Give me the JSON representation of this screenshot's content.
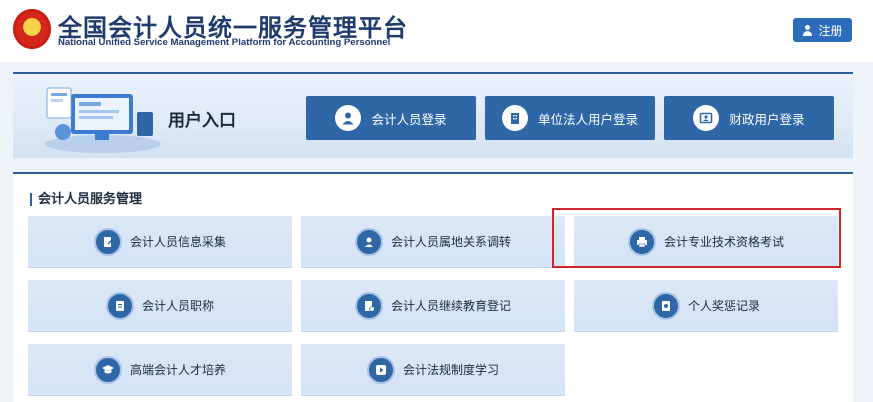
{
  "header": {
    "title": "全国会计人员统一服务管理平台",
    "subtitle": "National Unified Service Management Platform for Accounting Personnel",
    "register_label": "注册"
  },
  "entry": {
    "title": "用户入口",
    "buttons": [
      {
        "label": "会计人员登录",
        "icon": "user-icon"
      },
      {
        "label": "单位法人用户登录",
        "icon": "building-icon"
      },
      {
        "label": "财政用户登录",
        "icon": "id-card-icon"
      }
    ]
  },
  "services": {
    "title": "会计人员服务管理",
    "tiles": [
      {
        "label": "会计人员信息采集",
        "icon": "edit-document-icon"
      },
      {
        "label": "会计人员属地关系调转",
        "icon": "location-user-icon"
      },
      {
        "label": "会计专业技术资格考试",
        "icon": "printer-icon",
        "highlighted": true
      },
      {
        "label": "会计人员职称",
        "icon": "certificate-icon"
      },
      {
        "label": "会计人员继续教育登记",
        "icon": "education-record-icon"
      },
      {
        "label": "个人奖惩记录",
        "icon": "award-record-icon"
      },
      {
        "label": "高端会计人才培养",
        "icon": "graduation-cap-icon"
      },
      {
        "label": "会计法规制度学习",
        "icon": "play-icon"
      }
    ]
  },
  "colors": {
    "primary": "#2f67a6",
    "title_blue": "#1f3b6d",
    "highlight_red": "#d0262a",
    "tile_bg": "#dce8f7"
  }
}
